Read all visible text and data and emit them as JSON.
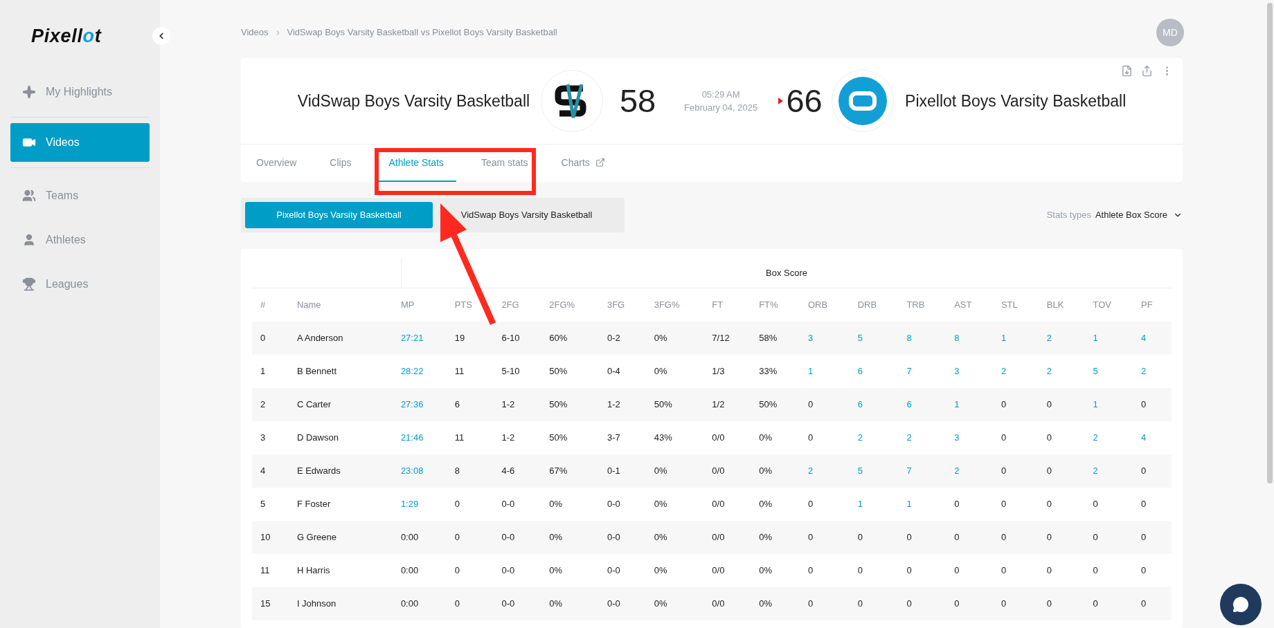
{
  "sidebar": {
    "items": [
      {
        "label": "My Highlights",
        "selected": false
      },
      {
        "label": "Videos",
        "selected": true
      },
      {
        "label": "Teams",
        "selected": false
      },
      {
        "label": "Athletes",
        "selected": false
      },
      {
        "label": "Leagues",
        "selected": false
      }
    ]
  },
  "logo": {
    "text": "Pixell",
    "accent": "o",
    "tail": "t"
  },
  "breadcrumb": [
    "Videos",
    "VidSwap Boys Varsity Basketball vs Pixellot Boys Varsity Basketball"
  ],
  "user": {
    "initials": "MD"
  },
  "game": {
    "home": {
      "name": "VidSwap Boys Varsity Basketball",
      "score": "58",
      "winner": false
    },
    "time": "05:29 AM",
    "date": "February 04, 2025",
    "away": {
      "name": "Pixellot Boys Varsity Basketball",
      "score": "66",
      "winner": true
    }
  },
  "tabs": [
    {
      "label": "Overview",
      "selected": false,
      "external": false
    },
    {
      "label": "Clips",
      "selected": false,
      "external": false
    },
    {
      "label": "Athlete Stats",
      "selected": true,
      "external": false
    },
    {
      "label": "Team stats",
      "selected": false,
      "external": false
    },
    {
      "label": "Charts",
      "selected": false,
      "external": true
    }
  ],
  "team_toggle": [
    {
      "label": "Pixellot Boys Varsity Basketball",
      "selected": true
    },
    {
      "label": "VidSwap Boys Varsity Basketball",
      "selected": false
    }
  ],
  "stats_type": {
    "label": "Stats types",
    "value": "Athlete Box Score"
  },
  "table": {
    "group_header": "Box Score",
    "columns": [
      "#",
      "Name",
      "MP",
      "PTS",
      "2FG",
      "2FG%",
      "3FG",
      "3FG%",
      "FT",
      "FT%",
      "ORB",
      "DRB",
      "TRB",
      "AST",
      "STL",
      "BLK",
      "TOV",
      "PF"
    ],
    "rows": [
      {
        "cells": [
          {
            "text": "0",
            "link": false
          },
          {
            "text": "A Anderson",
            "link": false
          },
          {
            "text": "27:21",
            "link": true
          },
          {
            "text": "19",
            "link": false
          },
          {
            "text": "6-10",
            "link": false
          },
          {
            "text": "60%",
            "link": false
          },
          {
            "text": "0-2",
            "link": false
          },
          {
            "text": "0%",
            "link": false
          },
          {
            "text": "7/12",
            "link": false
          },
          {
            "text": "58%",
            "link": false
          },
          {
            "text": "3",
            "link": true
          },
          {
            "text": "5",
            "link": true
          },
          {
            "text": "8",
            "link": true
          },
          {
            "text": "8",
            "link": true
          },
          {
            "text": "1",
            "link": true
          },
          {
            "text": "2",
            "link": true
          },
          {
            "text": "1",
            "link": true
          },
          {
            "text": "4",
            "link": true
          }
        ]
      },
      {
        "cells": [
          {
            "text": "1",
            "link": false
          },
          {
            "text": "B Bennett",
            "link": false
          },
          {
            "text": "28:22",
            "link": true
          },
          {
            "text": "11",
            "link": false
          },
          {
            "text": "5-10",
            "link": false
          },
          {
            "text": "50%",
            "link": false
          },
          {
            "text": "0-4",
            "link": false
          },
          {
            "text": "0%",
            "link": false
          },
          {
            "text": "1/3",
            "link": false
          },
          {
            "text": "33%",
            "link": false
          },
          {
            "text": "1",
            "link": true
          },
          {
            "text": "6",
            "link": true
          },
          {
            "text": "7",
            "link": true
          },
          {
            "text": "3",
            "link": true
          },
          {
            "text": "2",
            "link": true
          },
          {
            "text": "2",
            "link": true
          },
          {
            "text": "5",
            "link": true
          },
          {
            "text": "2",
            "link": true
          }
        ]
      },
      {
        "cells": [
          {
            "text": "2",
            "link": false
          },
          {
            "text": "C Carter",
            "link": false
          },
          {
            "text": "27:36",
            "link": true
          },
          {
            "text": "6",
            "link": false
          },
          {
            "text": "1-2",
            "link": false
          },
          {
            "text": "50%",
            "link": false
          },
          {
            "text": "1-2",
            "link": false
          },
          {
            "text": "50%",
            "link": false
          },
          {
            "text": "1/2",
            "link": false
          },
          {
            "text": "50%",
            "link": false
          },
          {
            "text": "0",
            "link": false
          },
          {
            "text": "6",
            "link": true
          },
          {
            "text": "6",
            "link": true
          },
          {
            "text": "1",
            "link": true
          },
          {
            "text": "0",
            "link": false
          },
          {
            "text": "0",
            "link": false
          },
          {
            "text": "1",
            "link": true
          },
          {
            "text": "0",
            "link": false
          }
        ]
      },
      {
        "cells": [
          {
            "text": "3",
            "link": false
          },
          {
            "text": "D Dawson",
            "link": false
          },
          {
            "text": "21:46",
            "link": true
          },
          {
            "text": "11",
            "link": false
          },
          {
            "text": "1-2",
            "link": false
          },
          {
            "text": "50%",
            "link": false
          },
          {
            "text": "3-7",
            "link": false
          },
          {
            "text": "43%",
            "link": false
          },
          {
            "text": "0/0",
            "link": false
          },
          {
            "text": "0%",
            "link": false
          },
          {
            "text": "0",
            "link": false
          },
          {
            "text": "2",
            "link": true
          },
          {
            "text": "2",
            "link": true
          },
          {
            "text": "3",
            "link": true
          },
          {
            "text": "0",
            "link": false
          },
          {
            "text": "0",
            "link": false
          },
          {
            "text": "2",
            "link": true
          },
          {
            "text": "4",
            "link": true
          }
        ]
      },
      {
        "cells": [
          {
            "text": "4",
            "link": false
          },
          {
            "text": "E Edwards",
            "link": false
          },
          {
            "text": "23:08",
            "link": true
          },
          {
            "text": "8",
            "link": false
          },
          {
            "text": "4-6",
            "link": false
          },
          {
            "text": "67%",
            "link": false
          },
          {
            "text": "0-1",
            "link": false
          },
          {
            "text": "0%",
            "link": false
          },
          {
            "text": "0/0",
            "link": false
          },
          {
            "text": "0%",
            "link": false
          },
          {
            "text": "2",
            "link": true
          },
          {
            "text": "5",
            "link": true
          },
          {
            "text": "7",
            "link": true
          },
          {
            "text": "2",
            "link": true
          },
          {
            "text": "0",
            "link": false
          },
          {
            "text": "0",
            "link": false
          },
          {
            "text": "2",
            "link": true
          },
          {
            "text": "0",
            "link": false
          }
        ]
      },
      {
        "cells": [
          {
            "text": "5",
            "link": false
          },
          {
            "text": "F Foster",
            "link": false
          },
          {
            "text": "1:29",
            "link": true
          },
          {
            "text": "0",
            "link": false
          },
          {
            "text": "0-0",
            "link": false
          },
          {
            "text": "0%",
            "link": false
          },
          {
            "text": "0-0",
            "link": false
          },
          {
            "text": "0%",
            "link": false
          },
          {
            "text": "0/0",
            "link": false
          },
          {
            "text": "0%",
            "link": false
          },
          {
            "text": "0",
            "link": false
          },
          {
            "text": "1",
            "link": true
          },
          {
            "text": "1",
            "link": true
          },
          {
            "text": "0",
            "link": false
          },
          {
            "text": "0",
            "link": false
          },
          {
            "text": "0",
            "link": false
          },
          {
            "text": "0",
            "link": false
          },
          {
            "text": "0",
            "link": false
          }
        ]
      },
      {
        "cells": [
          {
            "text": "10",
            "link": false
          },
          {
            "text": "G Greene",
            "link": false
          },
          {
            "text": "0:00",
            "link": false
          },
          {
            "text": "0",
            "link": false
          },
          {
            "text": "0-0",
            "link": false
          },
          {
            "text": "0%",
            "link": false
          },
          {
            "text": "0-0",
            "link": false
          },
          {
            "text": "0%",
            "link": false
          },
          {
            "text": "0/0",
            "link": false
          },
          {
            "text": "0%",
            "link": false
          },
          {
            "text": "0",
            "link": false
          },
          {
            "text": "0",
            "link": false
          },
          {
            "text": "0",
            "link": false
          },
          {
            "text": "0",
            "link": false
          },
          {
            "text": "0",
            "link": false
          },
          {
            "text": "0",
            "link": false
          },
          {
            "text": "0",
            "link": false
          },
          {
            "text": "0",
            "link": false
          }
        ]
      },
      {
        "cells": [
          {
            "text": "11",
            "link": false
          },
          {
            "text": "H Harris",
            "link": false
          },
          {
            "text": "0:00",
            "link": false
          },
          {
            "text": "0",
            "link": false
          },
          {
            "text": "0-0",
            "link": false
          },
          {
            "text": "0%",
            "link": false
          },
          {
            "text": "0-0",
            "link": false
          },
          {
            "text": "0%",
            "link": false
          },
          {
            "text": "0/0",
            "link": false
          },
          {
            "text": "0%",
            "link": false
          },
          {
            "text": "0",
            "link": false
          },
          {
            "text": "0",
            "link": false
          },
          {
            "text": "0",
            "link": false
          },
          {
            "text": "0",
            "link": false
          },
          {
            "text": "0",
            "link": false
          },
          {
            "text": "0",
            "link": false
          },
          {
            "text": "0",
            "link": false
          },
          {
            "text": "0",
            "link": false
          }
        ]
      },
      {
        "cells": [
          {
            "text": "15",
            "link": false
          },
          {
            "text": "I Johnson",
            "link": false
          },
          {
            "text": "0:00",
            "link": false
          },
          {
            "text": "0",
            "link": false
          },
          {
            "text": "0-0",
            "link": false
          },
          {
            "text": "0%",
            "link": false
          },
          {
            "text": "0-0",
            "link": false
          },
          {
            "text": "0%",
            "link": false
          },
          {
            "text": "0/0",
            "link": false
          },
          {
            "text": "0%",
            "link": false
          },
          {
            "text": "0",
            "link": false
          },
          {
            "text": "0",
            "link": false
          },
          {
            "text": "0",
            "link": false
          },
          {
            "text": "0",
            "link": false
          },
          {
            "text": "0",
            "link": false
          },
          {
            "text": "0",
            "link": false
          },
          {
            "text": "0",
            "link": false
          },
          {
            "text": "0",
            "link": false
          }
        ]
      }
    ]
  }
}
